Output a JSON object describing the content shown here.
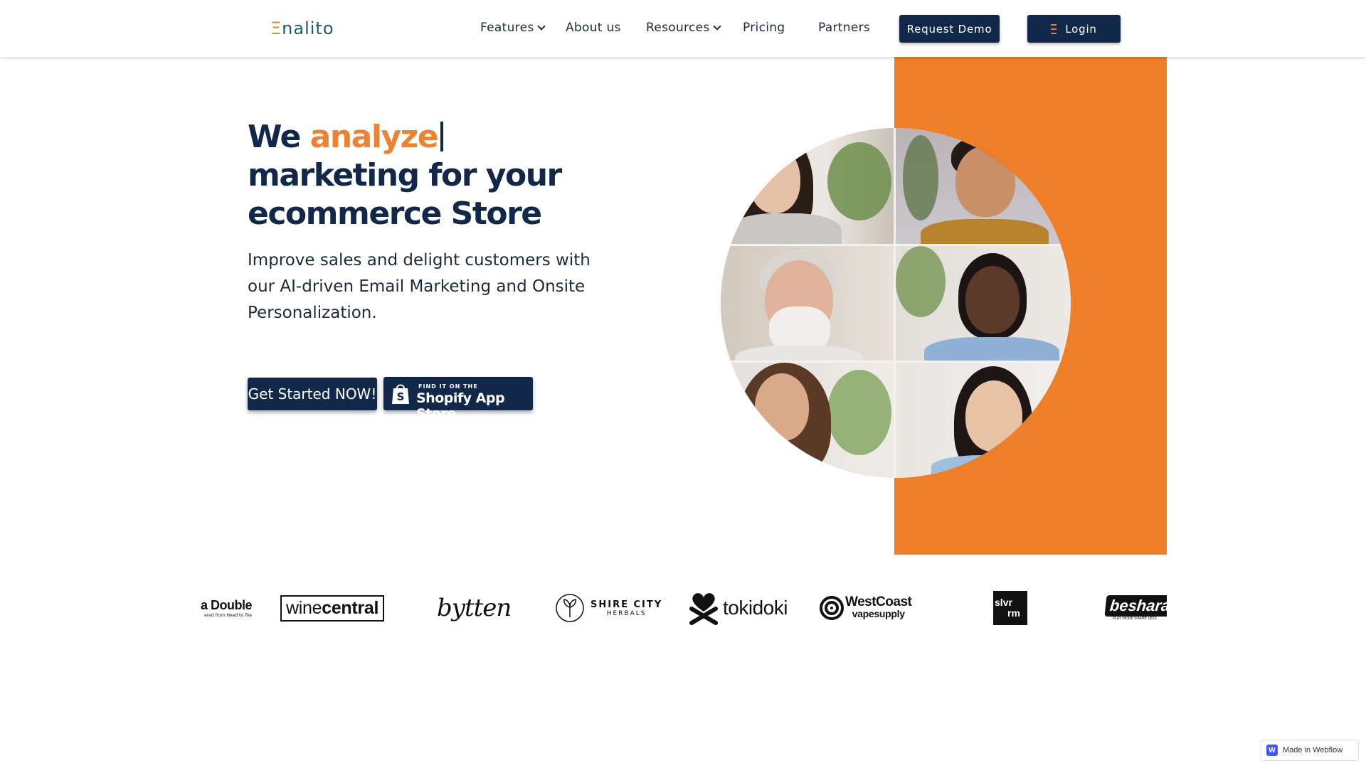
{
  "header": {
    "logo": "Enalito",
    "nav": [
      {
        "label": "Features",
        "dropdown": true
      },
      {
        "label": "About us",
        "dropdown": false
      },
      {
        "label": "Resources",
        "dropdown": true
      },
      {
        "label": "Pricing",
        "dropdown": false
      },
      {
        "label": "Partners",
        "dropdown": false
      }
    ],
    "request_demo": "Request Demo",
    "login": "Login"
  },
  "hero": {
    "headline_prefix": "We",
    "headline_accent": "analyze",
    "headline_rest_line1": "marketing for your",
    "headline_rest_line2": "ecommerce Store",
    "subtext": "Improve sales and delight customers with our AI-driven Email Marketing and Onsite Personalization.",
    "cta": "Get Started NOW!",
    "shopify_small": "FIND IT ON THE",
    "shopify_big": "Shopify App Store"
  },
  "logos": {
    "items": [
      {
        "name": "a Double",
        "tagline": "ered from Head to Toe"
      },
      {
        "name_light": "wine",
        "name_bold": "central"
      },
      {
        "name": "bytten"
      },
      {
        "name_top": "SHIRE CITY",
        "name_bottom": "HERBALS"
      },
      {
        "name": "tokidoki"
      },
      {
        "name_top": "WestCoast",
        "name_bottom": "vapesupply"
      },
      {
        "name_top": "slvr",
        "name_bottom": "rm"
      },
      {
        "name": "besharam",
        "tagline": "PLAY MORE SHAME LESS"
      }
    ]
  },
  "badge": {
    "label": "Made in Webflow",
    "icon_letter": "W"
  },
  "colors": {
    "navy": "#12284a",
    "orange": "#ef7e28",
    "accent_text": "#ee8233"
  }
}
